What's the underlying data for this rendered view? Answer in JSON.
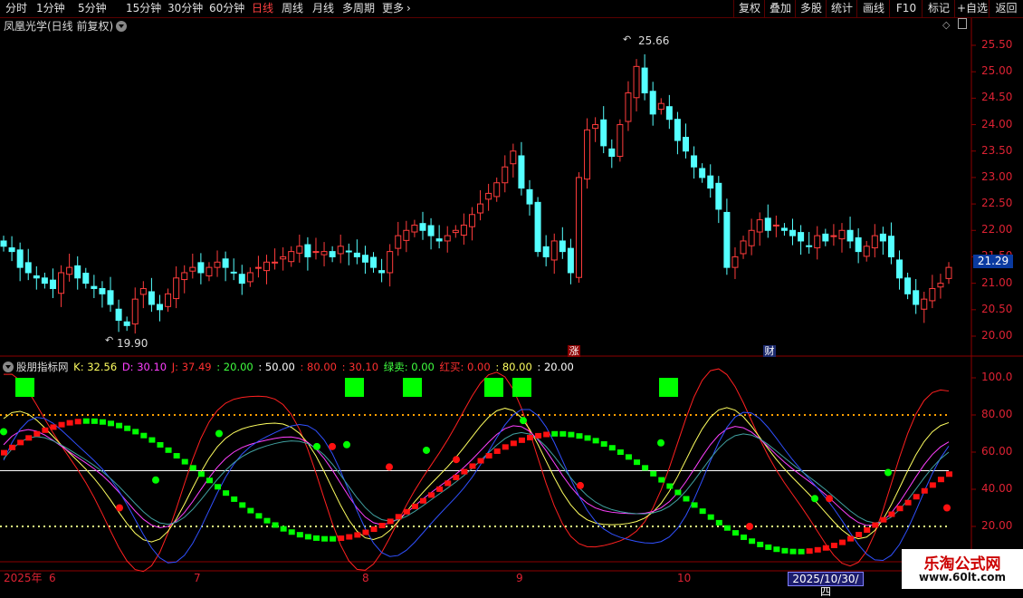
{
  "toolbar": {
    "periods": [
      "分时",
      "1分钟",
      "5分钟",
      "15分钟",
      "30分钟",
      "60分钟",
      "日线",
      "周线",
      "月线",
      "多周期",
      "更多"
    ],
    "active_period": "日线",
    "more_arrow": "›",
    "right_buttons": [
      "复权",
      "叠加",
      "多股",
      "统计",
      "画线",
      "F10",
      "标记",
      "+自选",
      "返回"
    ]
  },
  "stock": {
    "title": "凤凰光学(日线 前复权)",
    "current_price": "21.29",
    "high_label": "25.66",
    "low_label": "19.90"
  },
  "price_axis": [
    "25.50",
    "25.00",
    "24.50",
    "24.00",
    "23.50",
    "23.00",
    "22.50",
    "22.00",
    "21.50",
    "21.00",
    "20.50",
    "20.00"
  ],
  "markers": {
    "rise": "涨",
    "finance": "财"
  },
  "indicator": {
    "name": "股朋指标网",
    "k": "K: 32.56",
    "d": "D: 30.10",
    "j": "J: 37.49",
    "v20": ": 20.00",
    "v50": ": 50.00",
    "v80": ": 80.00",
    "v3010": ": 30.10",
    "sell": "绿卖: 0.00",
    "buy": "红买: 0.00",
    "v80b": ": 80.00",
    "v20b": ": 20.00"
  },
  "indicator_axis": [
    "100.0",
    "80.00",
    "60.00",
    "40.00",
    "20.00"
  ],
  "date_axis": {
    "year": "2025年",
    "months": [
      "6",
      "7",
      "8",
      "9",
      "10"
    ],
    "cursor_date": "2025/10/30/四"
  },
  "watermark": {
    "title": "乐淘公式网",
    "url": "www.60lt.com"
  },
  "colors": {
    "up": "#ff3c3c",
    "down": "#54ffff",
    "axis": "#8b0000",
    "k_line": "#ffff60",
    "d_line": "#ff40ff",
    "j_line": "#ff2020",
    "green_signal": "#00ff00",
    "red_signal": "#ff1010"
  }
}
